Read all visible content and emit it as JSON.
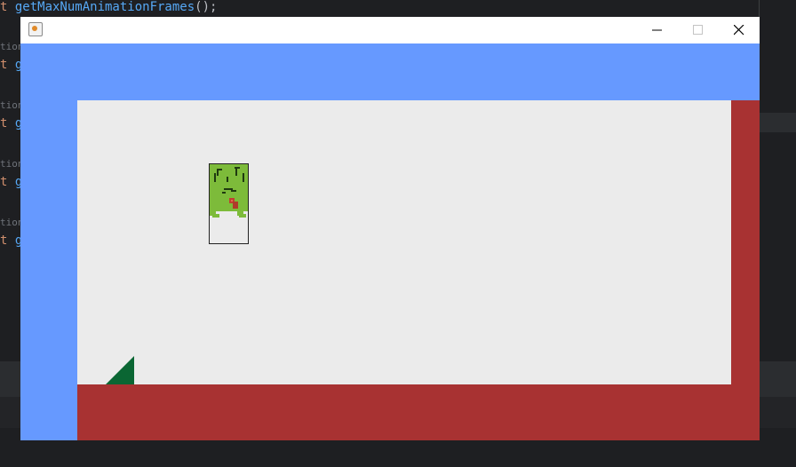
{
  "ide": {
    "code_line_keyword": "t ",
    "code_line_function": "getMaxNumAnimationFrames",
    "code_line_punct": "();",
    "gutter_label": "tion",
    "fragment_keyword": "t",
    "fragment_function": "g"
  },
  "window": {
    "title": "",
    "icon": "java-icon",
    "controls": [
      "minimize-icon",
      "maximize-icon",
      "close-icon"
    ]
  },
  "game": {
    "colors": {
      "sky": "#6699ff",
      "room": "#ebebeb",
      "wall": "#a83232",
      "ramp": "#0a6633",
      "player": "#7dbb3a"
    },
    "player_sprite": "frog-creature"
  }
}
